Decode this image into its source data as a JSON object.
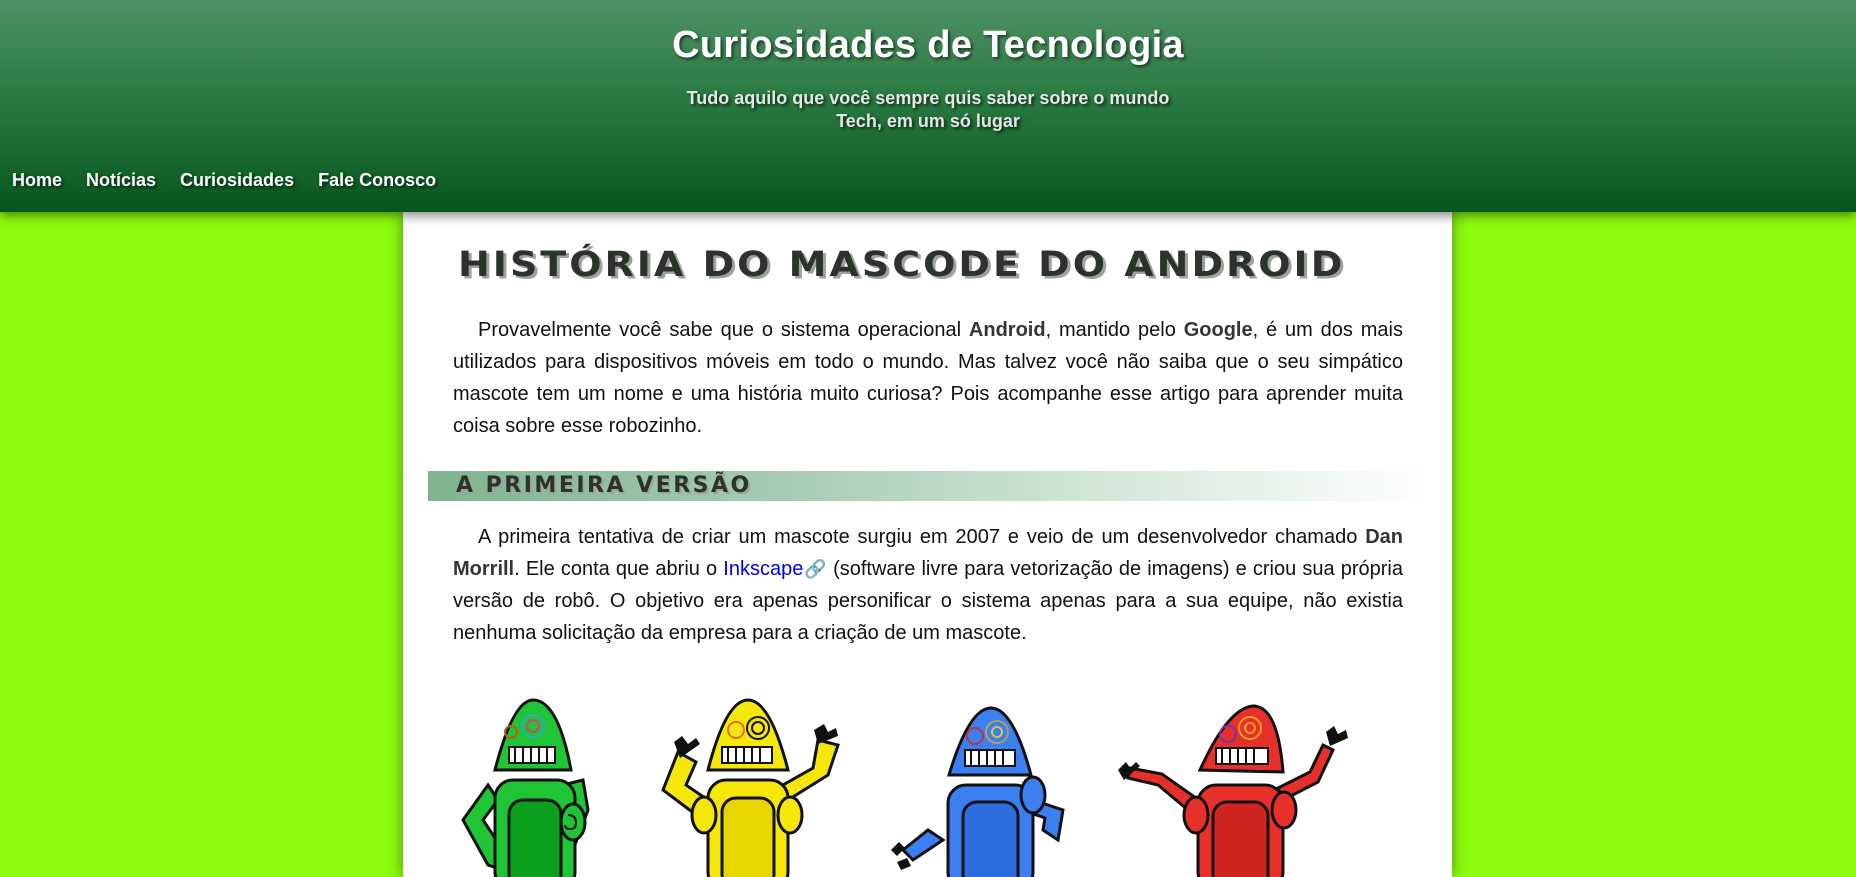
{
  "site": {
    "title": "Curiosidades de Tecnologia",
    "subtitle": "Tudo aquilo que você sempre quis saber sobre o mundo Tech, em um só lugar"
  },
  "nav": [
    {
      "label": "Home"
    },
    {
      "label": "Notícias"
    },
    {
      "label": "Curiosidades"
    },
    {
      "label": "Fale Conosco"
    }
  ],
  "article": {
    "title": "História do Mascode do Android",
    "intro": {
      "t1": "Provavelmente você sabe que o sistema operacional ",
      "b1": "Android",
      "t2": ", mantido pelo ",
      "b2": "Google",
      "t3": ", é um dos mais utilizados para dispositivos móveis em todo o mundo. Mas talvez você não saiba que o seu simpático mascote tem um nome e uma história muito curiosa? Pois acompanhe esse artigo para aprender muita coisa sobre esse robozinho."
    },
    "section1": {
      "title": "A Primeira Versão",
      "t1": "A primeira tentativa de criar um mascote surgiu em 2007 e veio de um desenvolvedor chamado ",
      "b1": "Dan Morrill",
      "t2": ". Ele conta que abriu o ",
      "link": "Inkscape",
      "t3": " (software livre para vetorização de imagens) e criou sua própria versão de robô. O objetivo era apenas personificar o sistema apenas para a sua equipe, não existia nenhuma solicitação da empresa para a criação de um mascote."
    },
    "robots": [
      {
        "color": "#1fc535"
      },
      {
        "color": "#f5e70a"
      },
      {
        "color": "#3b7ff0"
      },
      {
        "color": "#e8302a"
      }
    ]
  },
  "colors": {
    "background": "#8cfd0e",
    "header_top": "#4f9165",
    "header_bottom": "#07561e",
    "link": "#0000ee"
  },
  "icons": {
    "external_link": "link-icon"
  }
}
